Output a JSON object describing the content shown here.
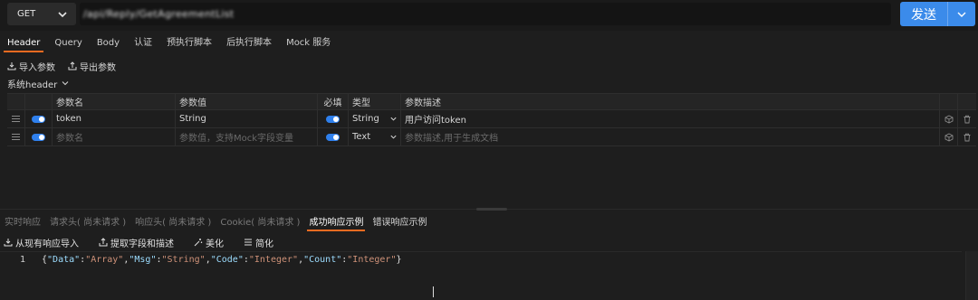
{
  "request": {
    "method": "GET",
    "url": "/api/Reply/GetAgreementList",
    "send_label": "发送"
  },
  "tabs": [
    "Header",
    "Query",
    "Body",
    "认证",
    "预执行脚本",
    "后执行脚本",
    "Mock 服务"
  ],
  "toolbar": {
    "import_label": "导入参数",
    "export_label": "导出参数",
    "system_header": "系统header"
  },
  "table": {
    "headers": [
      "参数名",
      "参数值",
      "必填",
      "类型",
      "参数描述"
    ],
    "rows": [
      {
        "name": "token",
        "value": "String",
        "type": "String",
        "desc": "用户访问token"
      }
    ],
    "new_row": {
      "name_placeholder": "参数名",
      "value_placeholder": "参数值，支持Mock字段变量",
      "type": "Text",
      "desc_placeholder": "参数描述,用于生成文档"
    }
  },
  "response": {
    "tabs": [
      "实时响应",
      "请求头( 尚未请求 )",
      "响应头( 尚未请求 )",
      "Cookie( 尚未请求 )",
      "成功响应示例",
      "错误响应示例"
    ],
    "tools": {
      "import_label": "从现有响应导入",
      "extract_label": "提取字段和描述",
      "beautify_label": "美化",
      "simplify_label": "简化"
    },
    "line_number": "1",
    "code": "{\"Data\":\"Array\",\"Msg\":\"String\",\"Code\":\"Integer\",\"Count\":\"Integer\"}"
  },
  "colors": {
    "accent": "#f26b21",
    "primary": "#3b8bea",
    "background": "#1e1e1e"
  }
}
